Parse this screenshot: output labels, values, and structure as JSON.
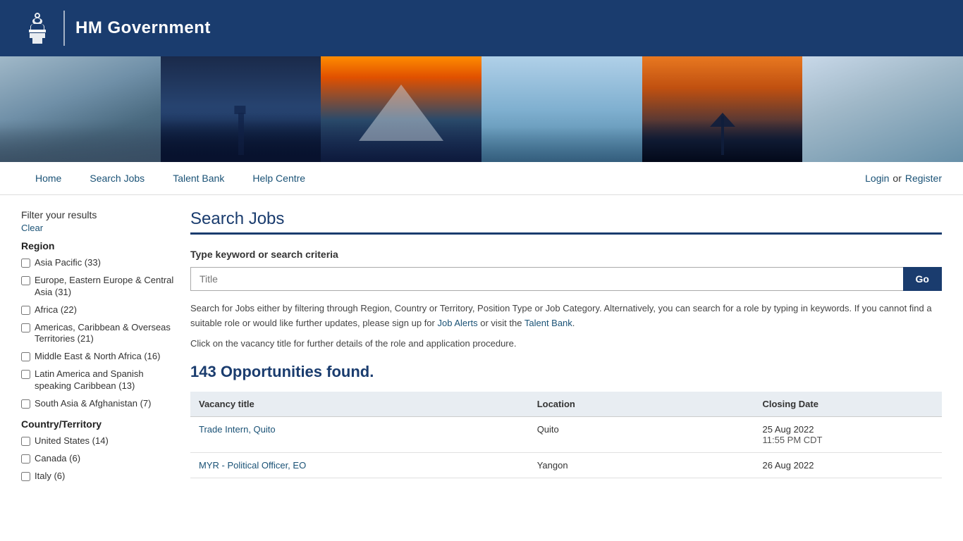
{
  "header": {
    "logo_text": "HM Government",
    "crest_symbol": "⚜"
  },
  "nav": {
    "links": [
      {
        "label": "Home",
        "id": "home"
      },
      {
        "label": "Search Jobs",
        "id": "search-jobs"
      },
      {
        "label": "Talent Bank",
        "id": "talent-bank"
      },
      {
        "label": "Help Centre",
        "id": "help-centre"
      }
    ],
    "login_label": "Login",
    "or_text": "or",
    "register_label": "Register"
  },
  "sidebar": {
    "filter_title": "Filter your results",
    "clear_label": "Clear",
    "region_section": "Region",
    "region_filters": [
      {
        "label": "Asia Pacific (33)",
        "id": "asia-pacific"
      },
      {
        "label": "Europe, Eastern Europe & Central Asia (31)",
        "id": "europe-eastern"
      },
      {
        "label": "Africa (22)",
        "id": "africa"
      },
      {
        "label": "Americas, Caribbean & Overseas Territories (21)",
        "id": "americas"
      },
      {
        "label": "Middle East & North Africa (16)",
        "id": "middle-east"
      },
      {
        "label": "Latin America and Spanish speaking Caribbean (13)",
        "id": "latin-america"
      },
      {
        "label": "South Asia & Afghanistan (7)",
        "id": "south-asia"
      }
    ],
    "country_section": "Country/Territory",
    "country_filters": [
      {
        "label": "United States (14)",
        "id": "united-states"
      },
      {
        "label": "Canada (6)",
        "id": "canada"
      },
      {
        "label": "Italy (6)",
        "id": "italy"
      }
    ]
  },
  "main": {
    "page_title": "Search Jobs",
    "search_criteria_label": "Type keyword or search criteria",
    "search_placeholder": "Title",
    "search_button": "Go",
    "description": "Search for Jobs either by filtering through Region, Country or Territory, Position Type or Job Category. Alternatively, you can search for a role by typing in keywords. If you cannot find a suitable role or would like further updates, please sign up for",
    "job_alerts_link": "Job Alerts",
    "or_visit_text": "or visit the",
    "talent_bank_link": "Talent Bank",
    "click_info": "Click on the vacancy title for further details of the role and application procedure.",
    "opportunities_count": "143 Opportunities found.",
    "table_headers": [
      "Vacancy title",
      "Location",
      "Closing Date"
    ],
    "vacancies": [
      {
        "title": "Trade Intern, Quito",
        "location": "Quito",
        "closing_date": "25 Aug 2022",
        "closing_time": "11:55 PM CDT"
      },
      {
        "title": "MYR - Political Officer, EO",
        "location": "Yangon",
        "closing_date": "26 Aug 2022",
        "closing_time": ""
      }
    ]
  }
}
